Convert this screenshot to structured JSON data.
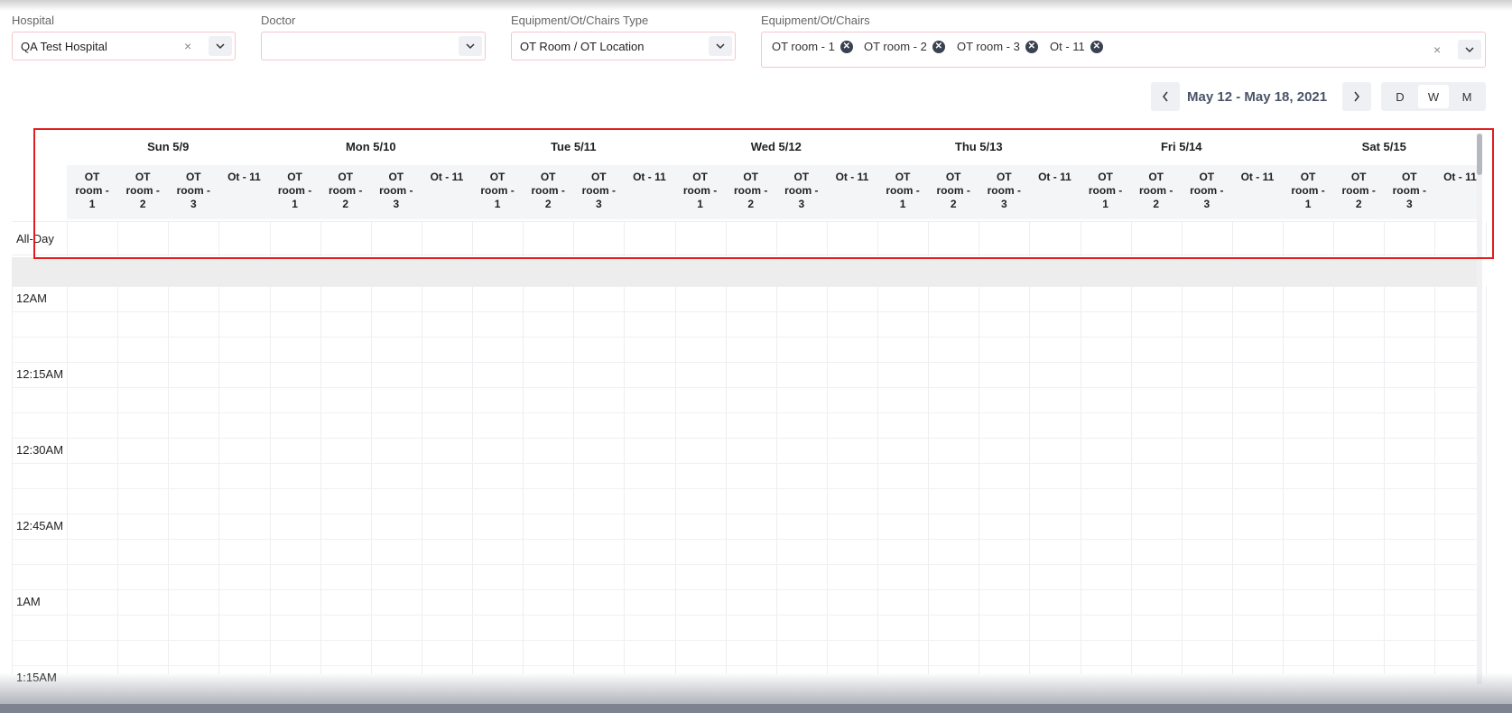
{
  "filters": {
    "hospital": {
      "label": "Hospital",
      "value": "QA Test Hospital",
      "clear": "×"
    },
    "doctor": {
      "label": "Doctor",
      "value": ""
    },
    "type": {
      "label": "Equipment/Ot/Chairs Type",
      "value": "OT Room / OT Location"
    },
    "resources": {
      "label": "Equipment/Ot/Chairs",
      "clear": "×",
      "chips": [
        {
          "label": "OT room - 1",
          "remove": "✕"
        },
        {
          "label": "OT room - 2",
          "remove": "✕"
        },
        {
          "label": "OT room - 3",
          "remove": "✕"
        },
        {
          "label": "Ot - 11",
          "remove": "✕"
        }
      ]
    }
  },
  "nav": {
    "range": "May 12 - May 18, 2021",
    "views": [
      "D",
      "W",
      "M"
    ],
    "active_view": "W"
  },
  "calendar": {
    "days": [
      "Sun 5/9",
      "Mon 5/10",
      "Tue 5/11",
      "Wed 5/12",
      "Thu 5/13",
      "Fri 5/14",
      "Sat 5/15"
    ],
    "resources": [
      [
        "OT",
        "room -",
        "1"
      ],
      [
        "OT",
        "room -",
        "2"
      ],
      [
        "OT",
        "room -",
        "3"
      ],
      [
        "Ot - 11"
      ]
    ],
    "allday_label": "All-Day",
    "time_labels": [
      "12AM",
      "12:15AM",
      "12:30AM",
      "12:45AM",
      "1AM",
      "1:15AM"
    ]
  },
  "colors": {
    "highlight": "#e01e1e",
    "header_bg": "#f4f5f7",
    "chip_x": "#3a4150"
  }
}
